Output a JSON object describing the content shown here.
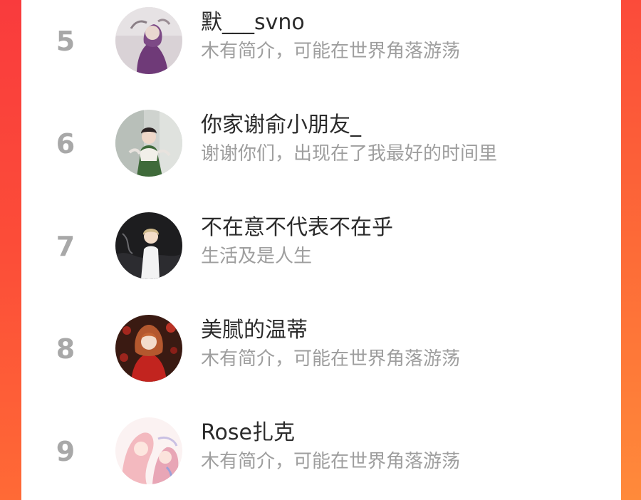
{
  "ranking": {
    "items": [
      {
        "rank": "5",
        "name": "默___svno",
        "bio": "木有简介，可能在世界角落游荡",
        "avatar_icon": "user-avatar-portrait-purple"
      },
      {
        "rank": "6",
        "name": "你家谢俞小朋友_",
        "bio": "谢谢你们，出现在了我最好的时间里",
        "avatar_icon": "user-avatar-hanfu-girl"
      },
      {
        "rank": "7",
        "name": "不在意不代表不在乎",
        "bio": "生活及是人生",
        "avatar_icon": "user-avatar-anime-boy"
      },
      {
        "rank": "8",
        "name": "美腻的温蒂",
        "bio": "木有简介，可能在世界角落游荡",
        "avatar_icon": "user-avatar-red-dress-girl"
      },
      {
        "rank": "9",
        "name": "Rose扎克",
        "bio": "木有简介，可能在世界角落游荡",
        "avatar_icon": "user-avatar-pink-anime-couple"
      }
    ]
  },
  "colors": {
    "rank_text": "#a8a8a8",
    "name_text": "#2b2b2b",
    "bio_text": "#9e9e9e",
    "background_gradient_top": "#fb3e3a",
    "background_gradient_bottom": "#ff8c3a"
  }
}
